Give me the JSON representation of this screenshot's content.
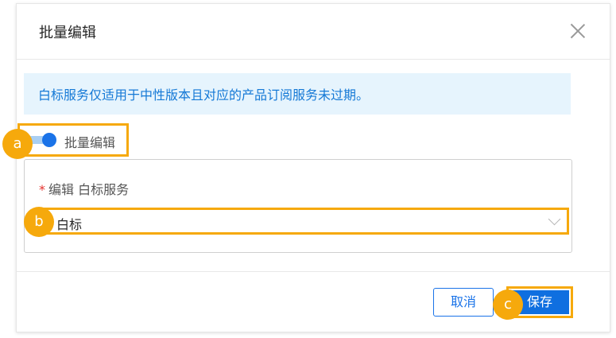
{
  "dialog": {
    "title": "批量编辑",
    "close_icon": "close-icon"
  },
  "info_banner": {
    "text": "白标服务仅适用于中性版本且对应的产品订阅服务未过期。",
    "bg_color": "#e6f4fd",
    "text_color": "#1579d6"
  },
  "batch_toggle": {
    "label": "批量编辑",
    "state": "on"
  },
  "field": {
    "required_mark": "*",
    "label": "编辑 白标服务",
    "selected_value": "白标"
  },
  "footer": {
    "cancel_label": "取消",
    "save_label": "保存"
  },
  "markers": {
    "a": "a",
    "b": "b",
    "c": "c"
  },
  "colors": {
    "accent": "#1a73e8",
    "highlight": "#f6a90c"
  }
}
